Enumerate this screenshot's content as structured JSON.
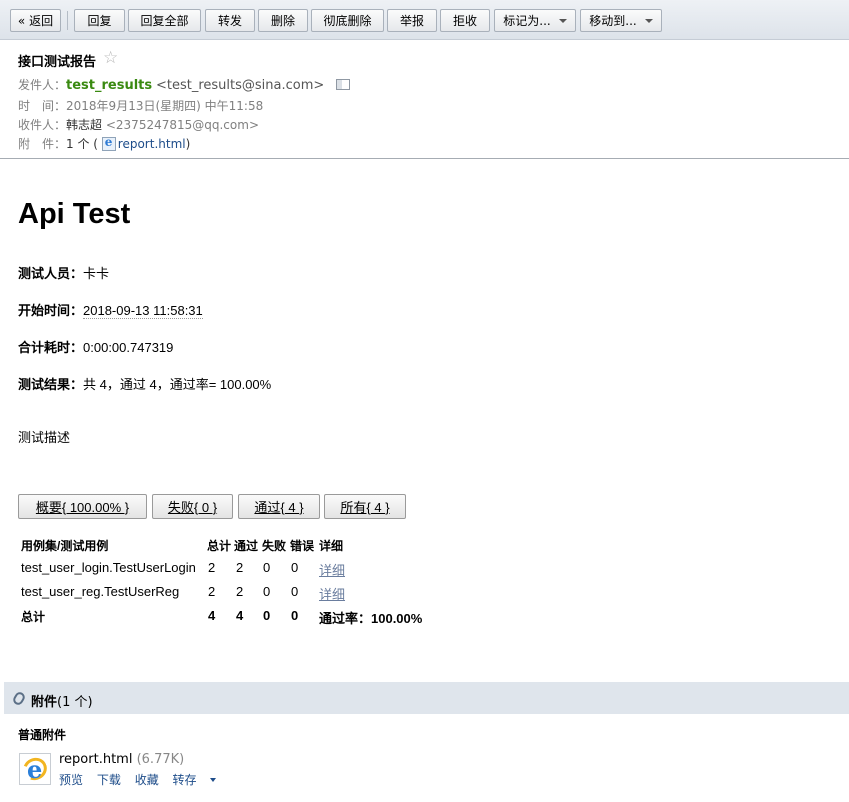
{
  "toolbar": {
    "back": "« 返回",
    "reply": "回复",
    "reply_all": "回复全部",
    "forward": "转发",
    "delete": "删除",
    "delete_permanent": "彻底删除",
    "report": "举报",
    "reject": "拒收",
    "mark_as": "标记为...",
    "move_to": "移动到..."
  },
  "header": {
    "subject": "接口测试报告",
    "star": "☆",
    "from_label": "发件人：",
    "from_name": "test_results",
    "from_email": "<test_results@sina.com>",
    "time_label": "时　间：",
    "time_value": "2018年9月13日(星期四) 中午11:58",
    "to_label": "收件人：",
    "to_name": "韩志超",
    "to_email": "<2375247815@qq.com>",
    "attach_label": "附　件：",
    "attach_count": "1 个 (",
    "attach_file": "report.html",
    "attach_close": ")"
  },
  "report": {
    "title": "Api Test",
    "tester_label": "测试人员：",
    "tester_value": "卡卡",
    "start_label": "开始时间：",
    "start_value": "2018-09-13 11:58:31",
    "duration_label": "合计耗时：",
    "duration_value": "0:00:00.747319",
    "result_label": "测试结果：",
    "result_value": "共 4，通过 4，通过率= 100.00%",
    "description": "测试描述",
    "filters": {
      "summary": "概要{ 100.00% }",
      "failed": "失败{ 0 }",
      "passed": "通过{ 4 }",
      "all": "所有{ 4 }"
    },
    "table": {
      "headers": [
        "用例集/测试用例",
        "总计",
        "通过",
        "失败",
        "错误",
        "详细"
      ],
      "rows": [
        {
          "name": "test_user_login.TestUserLogin",
          "total": "2",
          "pass": "2",
          "fail": "0",
          "error": "0",
          "detail": "详细"
        },
        {
          "name": "test_user_reg.TestUserReg",
          "total": "2",
          "pass": "2",
          "fail": "0",
          "error": "0",
          "detail": "详细"
        }
      ],
      "footer": {
        "name": "总计",
        "total": "4",
        "pass": "4",
        "fail": "0",
        "error": "0",
        "rate": "通过率：100.00%"
      }
    }
  },
  "attachments": {
    "title": "附件",
    "count": "(1 个)",
    "section": "普通附件",
    "file_name": "report.html",
    "file_size": "(6.77K)",
    "actions": {
      "preview": "预览",
      "download": "下载",
      "favorite": "收藏",
      "save_to": "转存"
    }
  }
}
